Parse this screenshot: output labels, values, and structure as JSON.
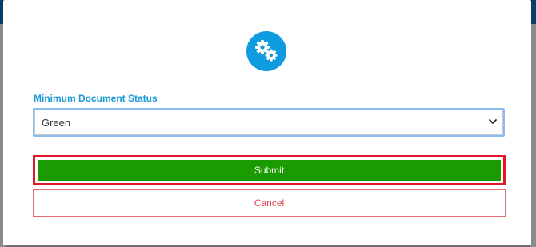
{
  "modal": {
    "icon": "gears-icon",
    "icon_color": "#0e9be0",
    "field_label": "Minimum Document Status",
    "select": {
      "selected": "Green",
      "options": [
        "Green"
      ]
    },
    "submit_label": "Submit",
    "cancel_label": "Cancel"
  },
  "colors": {
    "submit_bg": "#1b9b02",
    "submit_highlight": "#e0162b",
    "cancel_text": "#e0404e",
    "label_text": "#1a9ad6"
  }
}
